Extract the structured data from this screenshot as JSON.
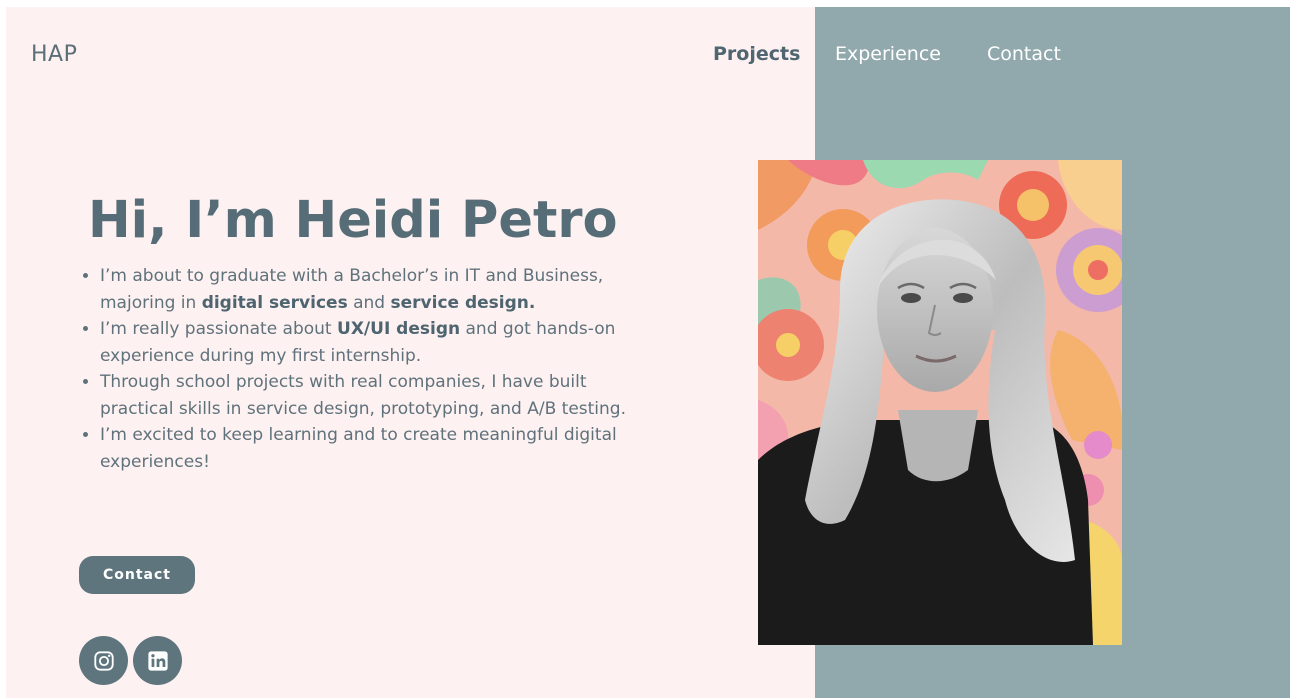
{
  "header": {
    "logo": "HAP",
    "nav": [
      "Projects",
      "Experience",
      "Contact"
    ]
  },
  "hero": {
    "title": "Hi, I’m Heidi Petro",
    "bio": [
      {
        "parts": [
          {
            "t": "I’m about to graduate with a Bachelor’s in IT and Business, majoring in ",
            "b": false
          },
          {
            "t": "digital services",
            "b": true
          },
          {
            "t": " and ",
            "b": false
          },
          {
            "t": "service design.",
            "b": true
          }
        ]
      },
      {
        "parts": [
          {
            "t": "I’m really passionate about ",
            "b": false
          },
          {
            "t": "UX/UI design",
            "b": true
          },
          {
            "t": " and got hands-on experience during my first internship.",
            "b": false
          }
        ]
      },
      {
        "parts": [
          {
            "t": "Through school projects with real companies, I have built practical skills in service design, prototyping, and A/B testing.",
            "b": false
          }
        ]
      },
      {
        "parts": [
          {
            "t": "I’m excited to keep learning and to create meaningful digital experiences!",
            "b": false
          }
        ]
      }
    ],
    "cta_label": "Contact"
  },
  "social": {
    "instagram_icon": "instagram-icon",
    "linkedin_icon": "linkedin-icon"
  },
  "colors": {
    "page_background": "#fdf1f1",
    "panel": "#91a8ad",
    "accent": "#5e757d",
    "text": "#5b6f78"
  }
}
